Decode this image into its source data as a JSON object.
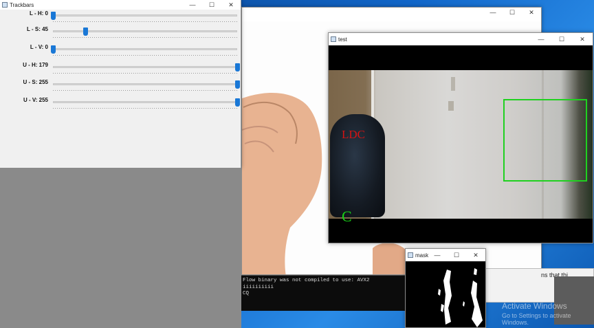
{
  "trackbars_window": {
    "title": "Trackbars",
    "controls": [
      "—",
      "☐",
      "✕"
    ],
    "sliders": [
      {
        "label": "L - H: 0",
        "value": 0,
        "max": 179
      },
      {
        "label": "L - S: 45",
        "value": 45,
        "max": 255
      },
      {
        "label": "L - V: 0",
        "value": 0,
        "max": 255
      },
      {
        "label": "U - H: 179",
        "value": 179,
        "max": 179
      },
      {
        "label": "U - S: 255",
        "value": 255,
        "max": 255
      },
      {
        "label": "U - V: 255",
        "value": 255,
        "max": 255
      }
    ]
  },
  "back_window": {
    "controls": [
      "—",
      "☐",
      "✕"
    ]
  },
  "test_window": {
    "title": "test",
    "controls": [
      "—",
      "☐",
      "✕"
    ],
    "overlay_text_red": "LDC",
    "overlay_text_green": "C",
    "roi_color": "#1fd11f"
  },
  "mask_window": {
    "title": "mask",
    "controls": [
      "—",
      "☐",
      "✕"
    ]
  },
  "console": {
    "lines": [
      "Flow binary was not compiled to use: AVX2",
      "iiiiiiiiii",
      "CQ"
    ],
    "side_text": "ns that thi"
  },
  "watermark": {
    "line1": "Activate Windows",
    "line2": "Go to Settings to activate Windows."
  }
}
